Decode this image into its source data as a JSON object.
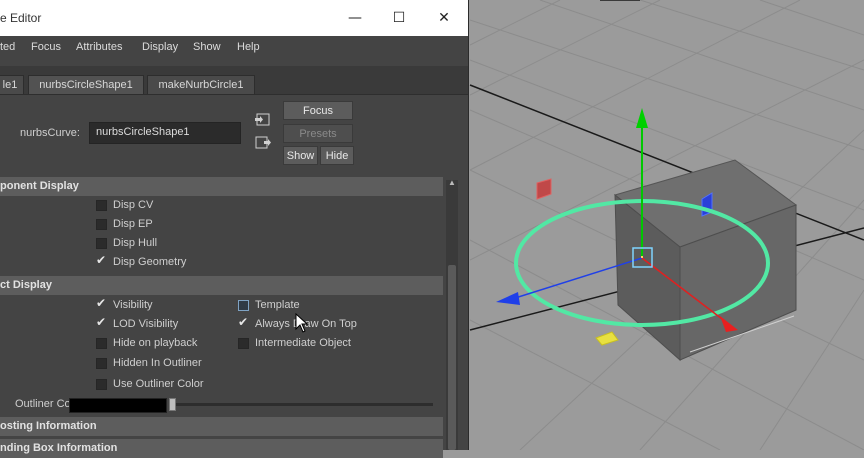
{
  "window": {
    "title": "e Editor",
    "minimize_glyph": "—",
    "maximize_glyph": "☐",
    "close_glyph": "✕"
  },
  "menu": [
    "ted",
    "Focus",
    "Attributes",
    "Display",
    "Show",
    "Help"
  ],
  "tabs": [
    "le1",
    "nurbsCircleShape1",
    "makeNurbCircle1"
  ],
  "node": {
    "label": "nurbsCurve:",
    "value": "nurbsCircleShape1"
  },
  "buttons": {
    "focus": "Focus",
    "presets": "Presets",
    "show": "Show",
    "hide": "Hide"
  },
  "sections": {
    "component_display": "ponent Display",
    "object_display": "ct Display",
    "ghosting": "osting Information",
    "bounding_box": "nding Box Information"
  },
  "component_display": [
    {
      "label": "Disp CV",
      "checked": false
    },
    {
      "label": "Disp EP",
      "checked": false
    },
    {
      "label": "Disp Hull",
      "checked": false
    },
    {
      "label": "Disp Geometry",
      "checked": true
    }
  ],
  "object_display_left": [
    {
      "label": "Visibility",
      "checked": true
    },
    {
      "label": "LOD Visibility",
      "checked": true
    },
    {
      "label": "Hide on playback",
      "checked": false
    },
    {
      "label": "Hidden In Outliner",
      "checked": false
    },
    {
      "label": "Use Outliner Color",
      "checked": false
    }
  ],
  "object_display_right": [
    {
      "label": "Template",
      "checked": false
    },
    {
      "label": "Always Draw On Top",
      "checked": true
    },
    {
      "label": "Intermediate Object",
      "checked": false
    }
  ],
  "outliner_color": {
    "label": "Outliner Color",
    "value": "#000000"
  },
  "colors": {
    "editor_bg": "#444444",
    "section_bg": "#5d5d5d",
    "viewport_bg": "#9b9b9b",
    "circle": "#4fe0a0",
    "axis_y": "#00c000",
    "axis_x": "#e02020",
    "axis_z": "#2040e0"
  }
}
